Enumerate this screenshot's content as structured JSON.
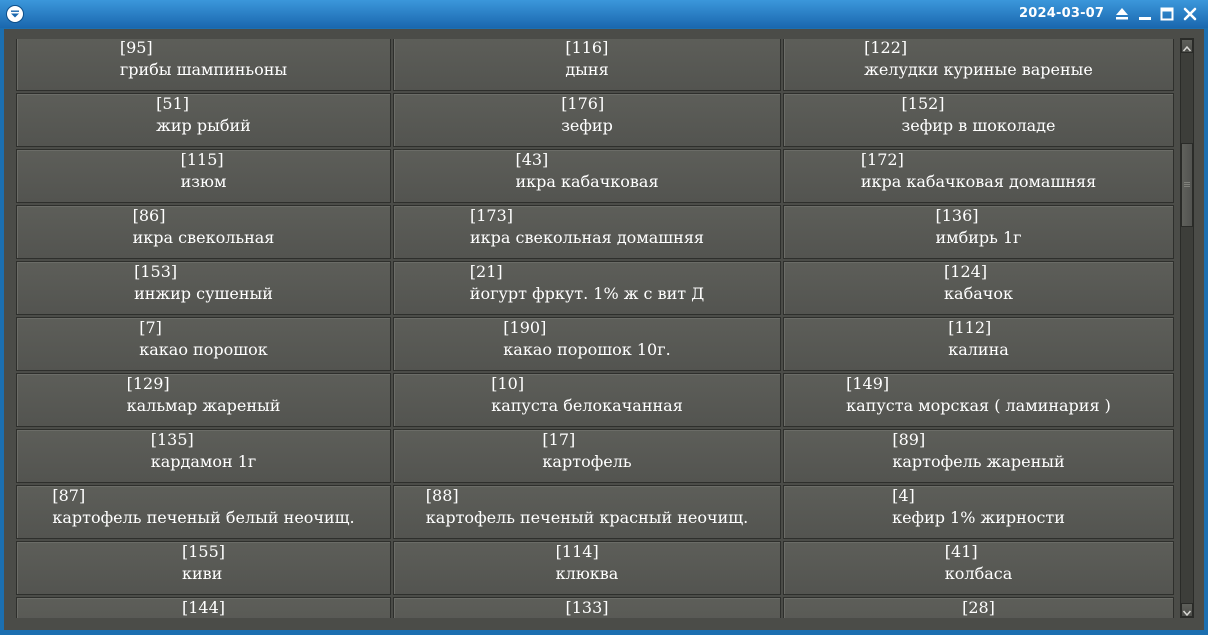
{
  "titlebar": {
    "date": "2024-03-07",
    "icons": [
      "window-menu-icon",
      "eject-icon",
      "minimize-icon",
      "maximize-icon",
      "close-icon"
    ]
  },
  "colors": {
    "titlebar": "#2a80c8",
    "background": "#4b4c48",
    "button": "#5a5b56",
    "text": "#ffffff"
  },
  "items": [
    {
      "id": "[95]",
      "name": "грибы шампиньоны"
    },
    {
      "id": "[116]",
      "name": "дыня"
    },
    {
      "id": "[122]",
      "name": "желудки куриные вареные"
    },
    {
      "id": "[51]",
      "name": "жир рыбий"
    },
    {
      "id": "[176]",
      "name": "зефир"
    },
    {
      "id": "[152]",
      "name": "зефир в шоколаде"
    },
    {
      "id": "[115]",
      "name": "изюм"
    },
    {
      "id": "[43]",
      "name": "икра кабачковая"
    },
    {
      "id": "[172]",
      "name": "икра кабачковая домашняя"
    },
    {
      "id": "[86]",
      "name": "икра свекольная"
    },
    {
      "id": "[173]",
      "name": "икра свекольная домашняя"
    },
    {
      "id": "[136]",
      "name": "имбирь 1г"
    },
    {
      "id": "[153]",
      "name": "инжир сушеный"
    },
    {
      "id": "[21]",
      "name": "йогурт фркут. 1% ж с вит Д"
    },
    {
      "id": "[124]",
      "name": "кабачок"
    },
    {
      "id": "[7]",
      "name": "какао порошок"
    },
    {
      "id": "[190]",
      "name": "какао порошок 10г."
    },
    {
      "id": "[112]",
      "name": "калина"
    },
    {
      "id": "[129]",
      "name": "кальмар жареный"
    },
    {
      "id": "[10]",
      "name": "капуста белокачанная"
    },
    {
      "id": "[149]",
      "name": "капуста морская ( ламинария )"
    },
    {
      "id": "[135]",
      "name": "кардамон 1г"
    },
    {
      "id": "[17]",
      "name": "картофель"
    },
    {
      "id": "[89]",
      "name": "картофель жареный"
    },
    {
      "id": "[87]",
      "name": "картофель печеный белый неочищ."
    },
    {
      "id": "[88]",
      "name": "картофель печеный красный неочищ."
    },
    {
      "id": "[4]",
      "name": "кефир 1% жирности"
    },
    {
      "id": "[155]",
      "name": "киви"
    },
    {
      "id": "[114]",
      "name": "клюква"
    },
    {
      "id": "[41]",
      "name": "колбаса"
    },
    {
      "id": "[144]",
      "name": ""
    },
    {
      "id": "[133]",
      "name": ""
    },
    {
      "id": "[28]",
      "name": ""
    }
  ]
}
